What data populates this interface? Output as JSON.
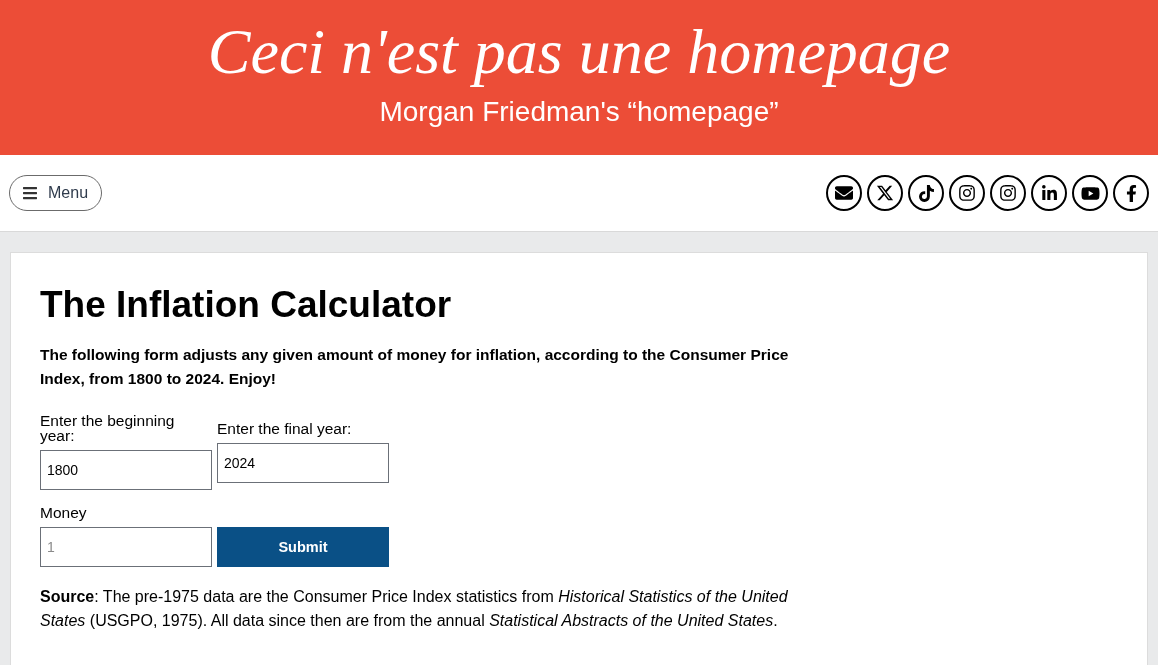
{
  "header": {
    "title": "Ceci n'est pas une homepage",
    "subtitle": "Morgan Friedman's “homepage”"
  },
  "nav": {
    "menu_button": {
      "label": "Menu"
    },
    "social_links": [
      {
        "kind": "email"
      },
      {
        "kind": "x"
      },
      {
        "kind": "tiktok"
      },
      {
        "kind": "instagram"
      },
      {
        "kind": "instagram"
      },
      {
        "kind": "linkedin"
      },
      {
        "kind": "youtube"
      },
      {
        "kind": "facebook"
      }
    ]
  },
  "main": {
    "title": "The Inflation Calculator",
    "intro": "The following form adjusts any given amount of money for inflation, according to the Consumer Price Index, from 1800 to 2024. Enjoy!",
    "form": {
      "year_fields": [
        {
          "label": "Enter the beginning year:",
          "value": "1800"
        },
        {
          "label": "Enter the final year:",
          "value": "2024"
        }
      ],
      "money_field": {
        "label": "Money",
        "placeholder": "1"
      },
      "submit": {
        "label": "Submit"
      }
    },
    "source": "**Source**: The pre-1975 data are the Consumer Price Index statistics from *Historical Statistics of the United States* (USGPO, 1975). All data since then are from the annual *Statistical Abstracts of the United States*."
  }
}
